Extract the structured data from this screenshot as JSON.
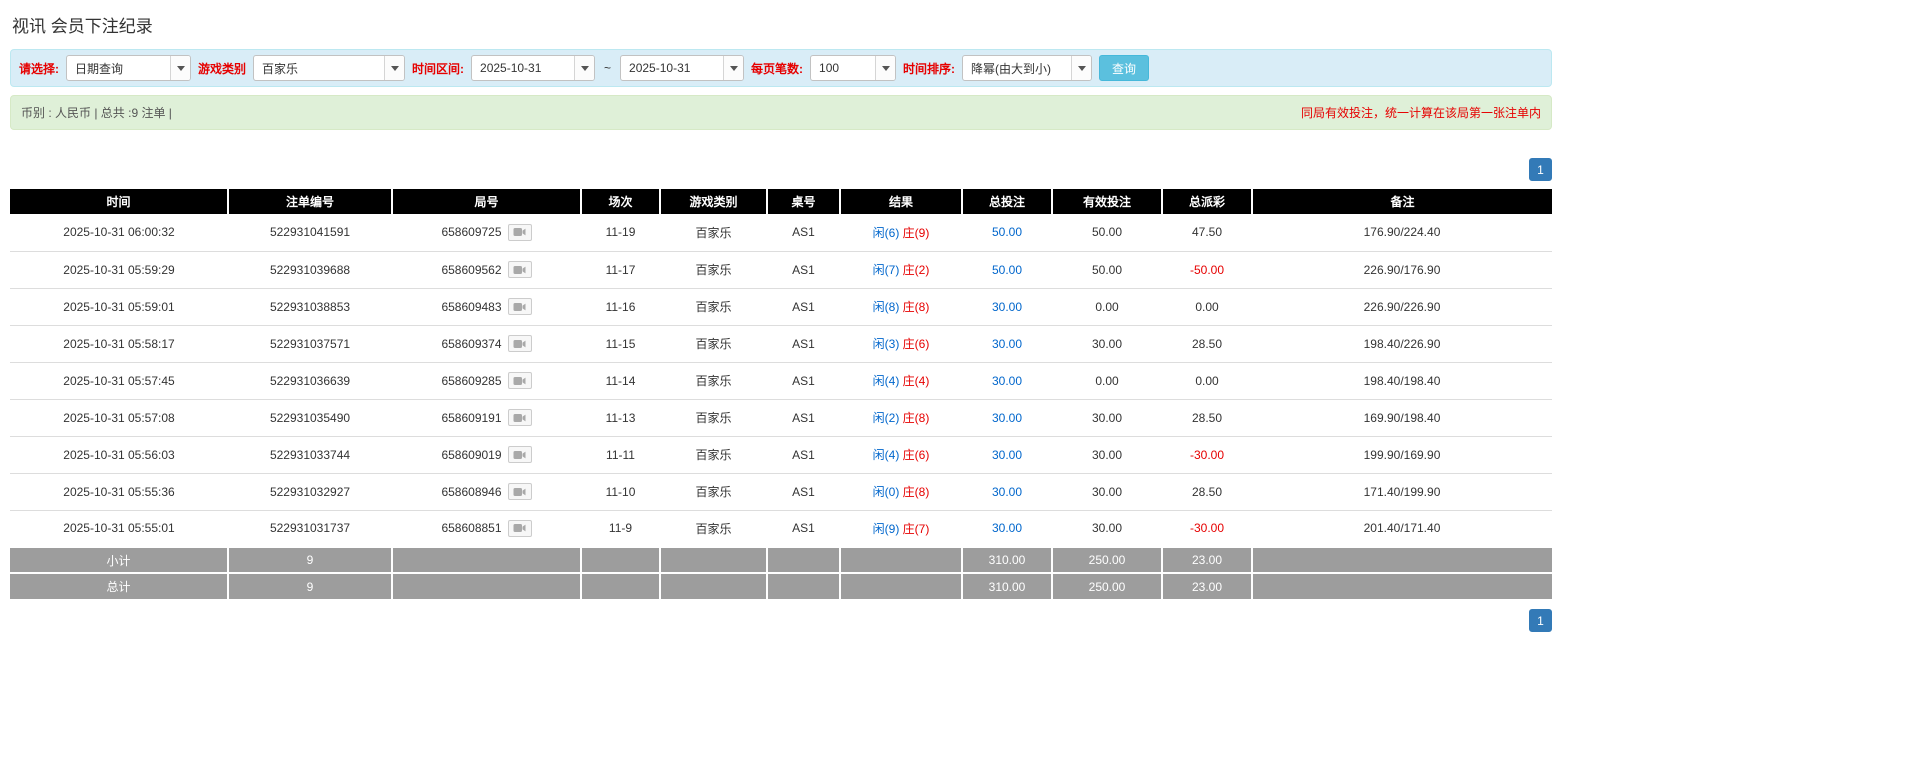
{
  "page": {
    "title": "视讯 会员下注纪录"
  },
  "filters": {
    "select_label": "请选择:",
    "select_value": "日期查询",
    "game_type_label": "游戏类别",
    "game_type_value": "百家乐",
    "date_range_label": "时间区间:",
    "date_from": "2025-10-31",
    "date_separator": "~",
    "date_to": "2025-10-31",
    "page_size_label": "每页笔数:",
    "page_size_value": "100",
    "sort_label": "时间排序:",
    "sort_value": "降幂(由大到小)",
    "search_button": "查询"
  },
  "summary": {
    "left": "币别 : 人民币 | 总共 :9 注单 |",
    "right": "同局有效投注，统一计算在该局第一张注单内"
  },
  "pagination": {
    "page": "1"
  },
  "icons": {
    "round_video": "video-icon",
    "combo_arrow": "chevron-down-icon"
  },
  "colors": {
    "accent_blue": "#337ab7",
    "link_blue": "#0066cc",
    "alert_red": "#e60000",
    "header_black": "#000000",
    "footer_gray": "#9d9d9d",
    "filter_bg": "#d9edf7",
    "summary_bg": "#dff0d8",
    "search_btn": "#5bc0de"
  },
  "table": {
    "headers": [
      "时间",
      "注单编号",
      "局号",
      "场次",
      "游戏类别",
      "桌号",
      "结果",
      "总投注",
      "有效投注",
      "总派彩",
      "备注"
    ],
    "rows": [
      {
        "time": "2025-10-31 06:00:32",
        "bet_id": "522931041591",
        "round_id": "658609725",
        "session": "11-19",
        "game": "百家乐",
        "table_no": "AS1",
        "result_player": "闲(6)",
        "result_banker": "庄(9)",
        "total_bet": "50.00",
        "valid_bet": "50.00",
        "payout": "47.50",
        "remark": "176.90/224.40"
      },
      {
        "time": "2025-10-31 05:59:29",
        "bet_id": "522931039688",
        "round_id": "658609562",
        "session": "11-17",
        "game": "百家乐",
        "table_no": "AS1",
        "result_player": "闲(7)",
        "result_banker": "庄(2)",
        "total_bet": "50.00",
        "valid_bet": "50.00",
        "payout": "-50.00",
        "remark": "226.90/176.90"
      },
      {
        "time": "2025-10-31 05:59:01",
        "bet_id": "522931038853",
        "round_id": "658609483",
        "session": "11-16",
        "game": "百家乐",
        "table_no": "AS1",
        "result_player": "闲(8)",
        "result_banker": "庄(8)",
        "total_bet": "30.00",
        "valid_bet": "0.00",
        "payout": "0.00",
        "remark": "226.90/226.90"
      },
      {
        "time": "2025-10-31 05:58:17",
        "bet_id": "522931037571",
        "round_id": "658609374",
        "session": "11-15",
        "game": "百家乐",
        "table_no": "AS1",
        "result_player": "闲(3)",
        "result_banker": "庄(6)",
        "total_bet": "30.00",
        "valid_bet": "30.00",
        "payout": "28.50",
        "remark": "198.40/226.90"
      },
      {
        "time": "2025-10-31 05:57:45",
        "bet_id": "522931036639",
        "round_id": "658609285",
        "session": "11-14",
        "game": "百家乐",
        "table_no": "AS1",
        "result_player": "闲(4)",
        "result_banker": "庄(4)",
        "total_bet": "30.00",
        "valid_bet": "0.00",
        "payout": "0.00",
        "remark": "198.40/198.40"
      },
      {
        "time": "2025-10-31 05:57:08",
        "bet_id": "522931035490",
        "round_id": "658609191",
        "session": "11-13",
        "game": "百家乐",
        "table_no": "AS1",
        "result_player": "闲(2)",
        "result_banker": "庄(8)",
        "total_bet": "30.00",
        "valid_bet": "30.00",
        "payout": "28.50",
        "remark": "169.90/198.40"
      },
      {
        "time": "2025-10-31 05:56:03",
        "bet_id": "522931033744",
        "round_id": "658609019",
        "session": "11-11",
        "game": "百家乐",
        "table_no": "AS1",
        "result_player": "闲(4)",
        "result_banker": "庄(6)",
        "total_bet": "30.00",
        "valid_bet": "30.00",
        "payout": "-30.00",
        "remark": "199.90/169.90"
      },
      {
        "time": "2025-10-31 05:55:36",
        "bet_id": "522931032927",
        "round_id": "658608946",
        "session": "11-10",
        "game": "百家乐",
        "table_no": "AS1",
        "result_player": "闲(0)",
        "result_banker": "庄(8)",
        "total_bet": "30.00",
        "valid_bet": "30.00",
        "payout": "28.50",
        "remark": "171.40/199.90"
      },
      {
        "time": "2025-10-31 05:55:01",
        "bet_id": "522931031737",
        "round_id": "658608851",
        "session": "11-9",
        "game": "百家乐",
        "table_no": "AS1",
        "result_player": "闲(9)",
        "result_banker": "庄(7)",
        "total_bet": "30.00",
        "valid_bet": "30.00",
        "payout": "-30.00",
        "remark": "201.40/171.40"
      }
    ],
    "footer": [
      {
        "label": "小计",
        "count": "9",
        "total_bet": "310.00",
        "valid_bet": "250.00",
        "payout": "23.00"
      },
      {
        "label": "总计",
        "count": "9",
        "total_bet": "310.00",
        "valid_bet": "250.00",
        "payout": "23.00"
      }
    ]
  }
}
